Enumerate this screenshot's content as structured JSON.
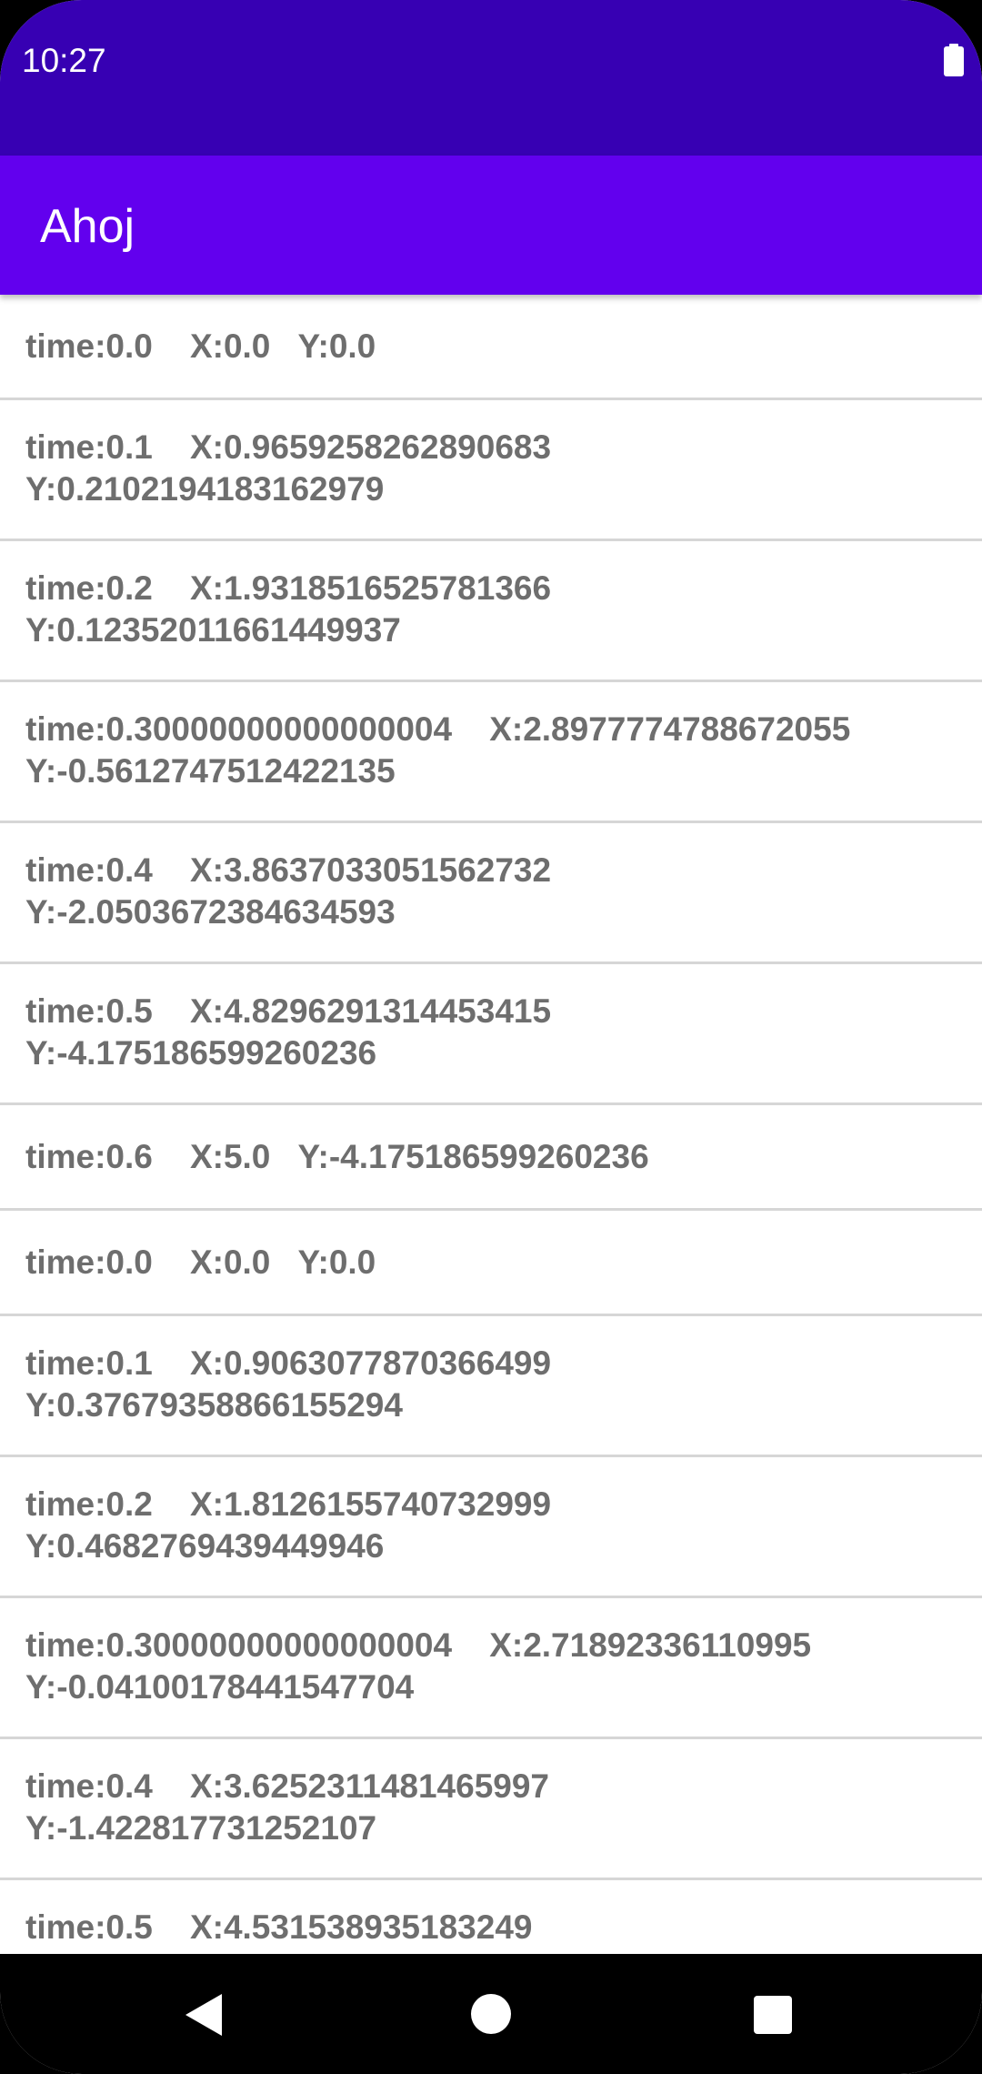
{
  "status_bar": {
    "time": "10:27",
    "battery_icon": "battery-full-icon"
  },
  "app_bar": {
    "title": "Ahoj"
  },
  "list": {
    "items": [
      "time:0.0    X:0.0   Y:0.0",
      "time:0.1    X:0.9659258262890683\nY:0.2102194183162979",
      "time:0.2    X:1.9318516525781366\nY:0.12352011661449937",
      "time:0.30000000000000004    X:2.8977774788672055\nY:-0.5612747512422135",
      "time:0.4    X:3.8637033051562732\nY:-2.0503672384634593",
      "time:0.5    X:4.8296291314453415\nY:-4.175186599260236",
      "time:0.6    X:5.0   Y:-4.175186599260236",
      "time:0.0    X:0.0   Y:0.0",
      "time:0.1    X:0.9063077870366499\nY:0.37679358866155294",
      "time:0.2    X:1.8126155740732999\nY:0.4682769439449946",
      "time:0.30000000000000004    X:2.71892336110995\nY:-0.04100178441547704",
      "time:0.4    X:3.6252311481465997\nY:-1.422817731252107",
      "time:0.5    X:4.531538935183249"
    ]
  },
  "nav_bar": {
    "back_icon": "back-triangle-icon",
    "home_icon": "home-circle-icon",
    "recents_icon": "recents-square-icon"
  },
  "colors": {
    "status_bar": "#3700b3",
    "app_bar": "#6200ee",
    "list_text": "#6e6e6e",
    "divider": "#d6d6d6"
  }
}
